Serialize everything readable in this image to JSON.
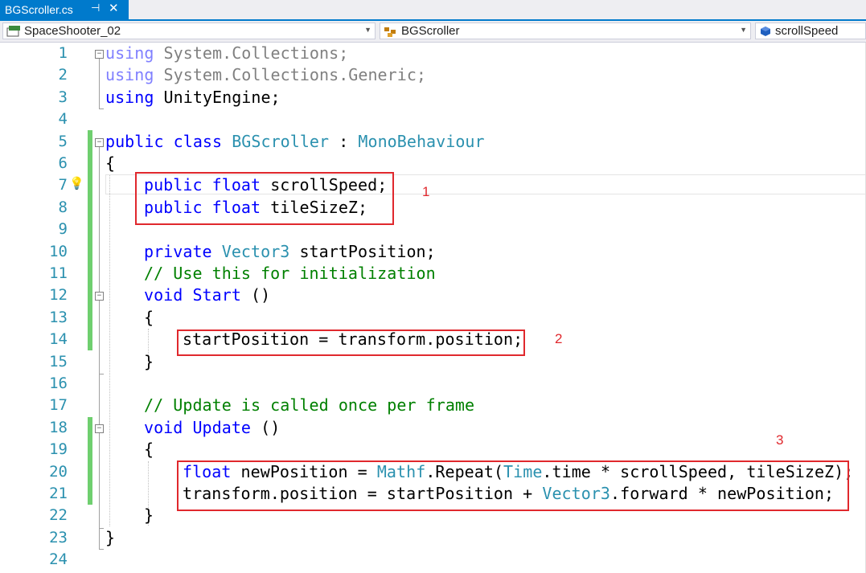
{
  "tab": {
    "title": "BGScroller.cs",
    "pin_glyph": "⊣",
    "close_glyph": "✕"
  },
  "nav": {
    "project": "SpaceShooter_02",
    "class": "BGScroller",
    "member": "scrollSpeed",
    "icons": {
      "project": "csharp-project-icon",
      "class": "class-icon",
      "member": "field-icon"
    }
  },
  "editor": {
    "lines": [
      {
        "n": "1",
        "tokens": [
          [
            "using",
            "dim-kw"
          ],
          [
            " System.Collections;",
            "gray"
          ]
        ]
      },
      {
        "n": "2",
        "tokens": [
          [
            "using",
            "dim-kw"
          ],
          [
            " System.Collections.Generic;",
            "gray"
          ]
        ]
      },
      {
        "n": "3",
        "tokens": [
          [
            "using",
            "kw"
          ],
          [
            " UnityEngine;",
            ""
          ]
        ]
      },
      {
        "n": "4",
        "tokens": []
      },
      {
        "n": "5",
        "tokens": [
          [
            "public",
            "kw"
          ],
          [
            " ",
            ""
          ],
          [
            "class",
            "kw"
          ],
          [
            " ",
            ""
          ],
          [
            "BGScroller",
            "ty"
          ],
          [
            " : ",
            ""
          ],
          [
            "MonoBehaviour",
            "ty"
          ]
        ]
      },
      {
        "n": "6",
        "tokens": [
          [
            "{",
            ""
          ]
        ]
      },
      {
        "n": "7",
        "tokens": [
          [
            "public",
            "kw"
          ],
          [
            " ",
            ""
          ],
          [
            "float",
            "kw"
          ],
          [
            " scrollSpeed;",
            ""
          ]
        ]
      },
      {
        "n": "8",
        "tokens": [
          [
            "public",
            "kw"
          ],
          [
            " ",
            ""
          ],
          [
            "float",
            "kw"
          ],
          [
            " tileSizeZ;",
            ""
          ]
        ]
      },
      {
        "n": "9",
        "tokens": []
      },
      {
        "n": "10",
        "tokens": [
          [
            "private",
            "kw"
          ],
          [
            " ",
            ""
          ],
          [
            "Vector3",
            "ty"
          ],
          [
            " startPosition;",
            ""
          ]
        ]
      },
      {
        "n": "11",
        "tokens": [
          [
            "// Use this for initialization",
            "cm"
          ]
        ]
      },
      {
        "n": "12",
        "tokens": [
          [
            "void",
            "kw"
          ],
          [
            " ",
            ""
          ],
          [
            "Start",
            "kw"
          ],
          [
            " ()",
            ""
          ]
        ]
      },
      {
        "n": "13",
        "tokens": [
          [
            "{",
            ""
          ]
        ]
      },
      {
        "n": "14",
        "tokens": [
          [
            "startPosition = transform.position;",
            ""
          ]
        ]
      },
      {
        "n": "15",
        "tokens": [
          [
            "}",
            ""
          ]
        ]
      },
      {
        "n": "16",
        "tokens": []
      },
      {
        "n": "17",
        "tokens": [
          [
            "// Update is called once per frame",
            "cm"
          ]
        ]
      },
      {
        "n": "18",
        "tokens": [
          [
            "void",
            "kw"
          ],
          [
            " ",
            ""
          ],
          [
            "Update",
            "kw"
          ],
          [
            " ()",
            ""
          ]
        ]
      },
      {
        "n": "19",
        "tokens": [
          [
            "{",
            ""
          ]
        ]
      },
      {
        "n": "20",
        "tokens": [
          [
            "float",
            "kw"
          ],
          [
            " newPosition = ",
            ""
          ],
          [
            "Mathf",
            "ty"
          ],
          [
            ".Repeat(",
            ""
          ],
          [
            "Time",
            "ty"
          ],
          [
            ".time * scrollSpeed, tileSizeZ);",
            ""
          ]
        ]
      },
      {
        "n": "21",
        "tokens": [
          [
            "transform.position = startPosition + ",
            ""
          ],
          [
            "Vector3",
            "ty"
          ],
          [
            ".forward * newPosition;",
            ""
          ]
        ]
      },
      {
        "n": "22",
        "tokens": [
          [
            "}",
            ""
          ]
        ]
      },
      {
        "n": "23",
        "tokens": [
          [
            "}",
            ""
          ]
        ]
      },
      {
        "n": "24",
        "tokens": []
      }
    ]
  },
  "annotations": {
    "a1": "1",
    "a2": "2",
    "a3": "3"
  },
  "colors": {
    "accent": "#007acc",
    "highlight": "#e0282d",
    "keyword": "#0000ff",
    "type": "#2b91af",
    "comment": "#008000"
  }
}
